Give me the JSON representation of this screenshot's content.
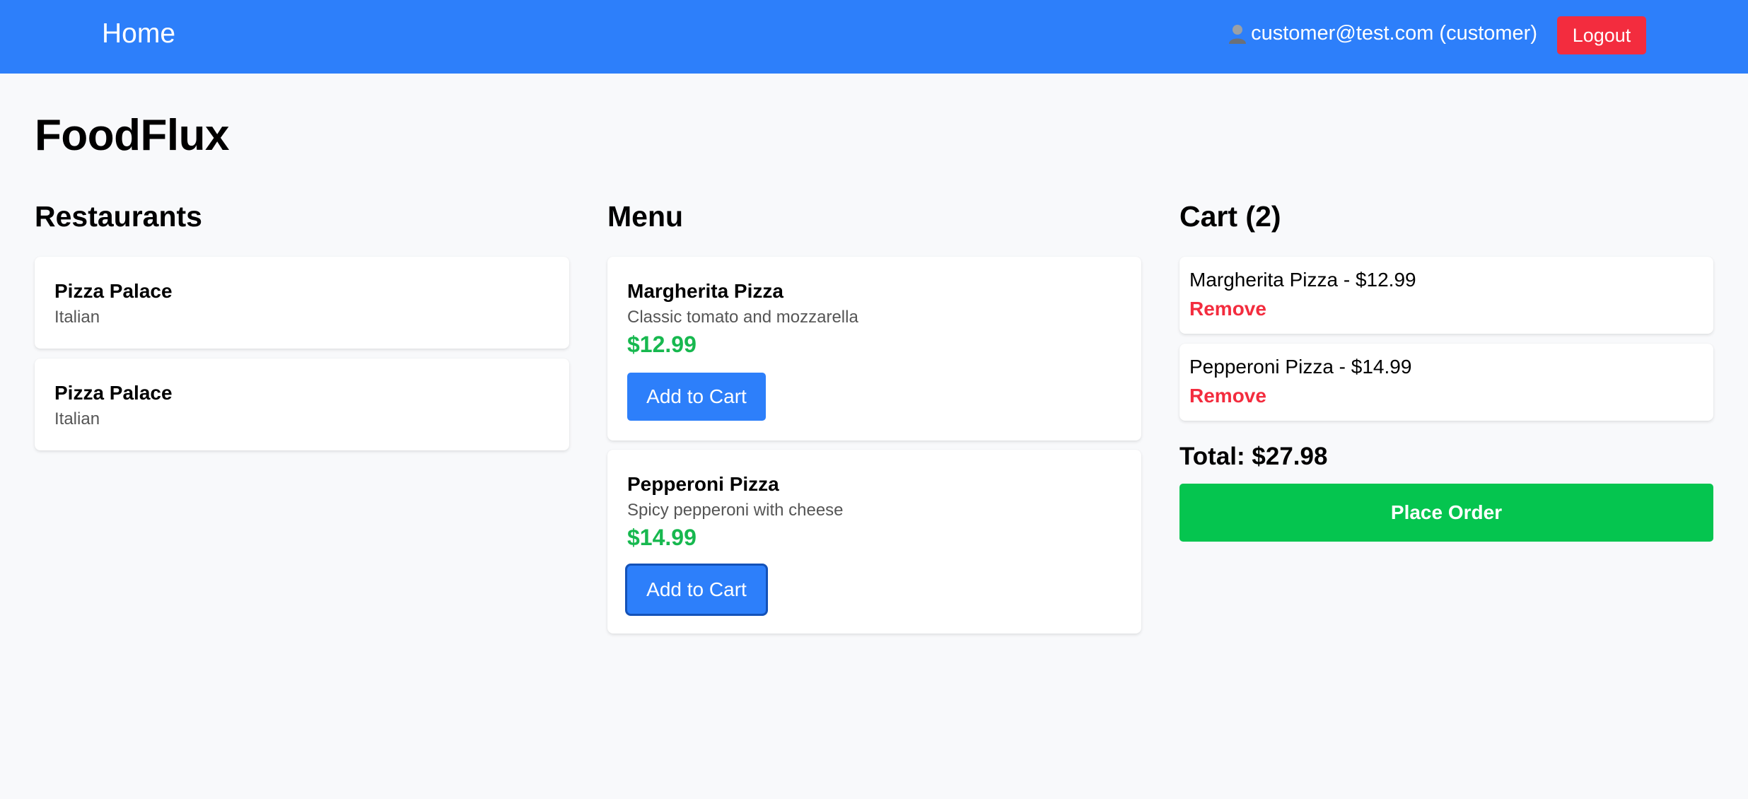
{
  "nav": {
    "home_label": "Home",
    "user_label": "customer@test.com (customer)",
    "logout_label": "Logout"
  },
  "page_title": "FoodFlux",
  "restaurants": {
    "title": "Restaurants",
    "items": [
      {
        "name": "Pizza Palace",
        "cuisine": "Italian"
      },
      {
        "name": "Pizza Palace",
        "cuisine": "Italian"
      }
    ]
  },
  "menu": {
    "title": "Menu",
    "items": [
      {
        "name": "Margherita Pizza",
        "description": "Classic tomato and mozzarella",
        "price": "$12.99",
        "button_label": "Add to Cart"
      },
      {
        "name": "Pepperoni Pizza",
        "description": "Spicy pepperoni with cheese",
        "price": "$14.99",
        "button_label": "Add to Cart"
      }
    ]
  },
  "cart": {
    "title": "Cart (2)",
    "items": [
      {
        "text": "Margherita Pizza - $12.99",
        "remove_label": "Remove"
      },
      {
        "text": "Pepperoni Pizza - $14.99",
        "remove_label": "Remove"
      }
    ],
    "total": "Total: $27.98",
    "place_order_label": "Place Order"
  },
  "icons": {
    "user": "user-icon"
  },
  "colors": {
    "navbar": "#2d7ffa",
    "logout": "#f32c3e",
    "price": "#17b84f",
    "remove": "#f32c3e",
    "place_order": "#05c54f",
    "add_to_cart": "#2d7ffa"
  }
}
